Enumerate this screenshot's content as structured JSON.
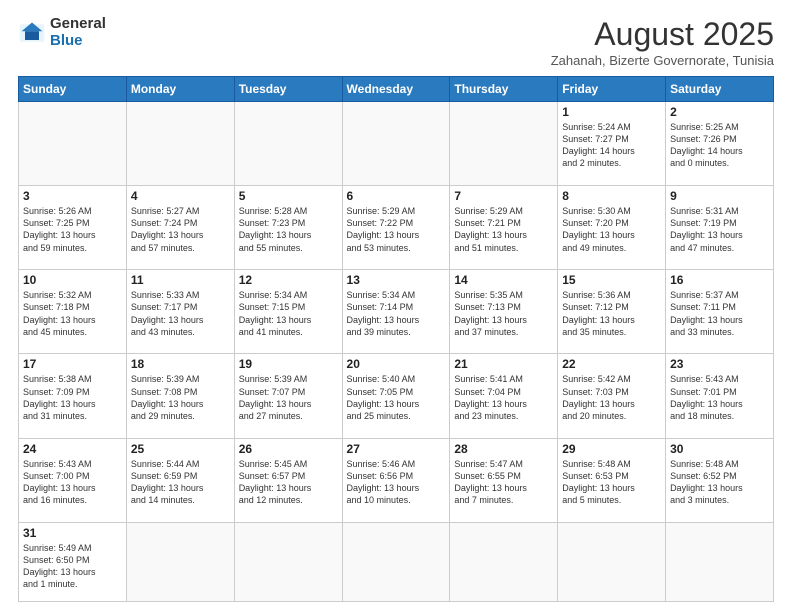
{
  "header": {
    "logo_general": "General",
    "logo_blue": "Blue",
    "month_title": "August 2025",
    "subtitle": "Zahanah, Bizerte Governorate, Tunisia"
  },
  "days_of_week": [
    "Sunday",
    "Monday",
    "Tuesday",
    "Wednesday",
    "Thursday",
    "Friday",
    "Saturday"
  ],
  "weeks": [
    [
      {
        "day": "",
        "info": ""
      },
      {
        "day": "",
        "info": ""
      },
      {
        "day": "",
        "info": ""
      },
      {
        "day": "",
        "info": ""
      },
      {
        "day": "",
        "info": ""
      },
      {
        "day": "1",
        "info": "Sunrise: 5:24 AM\nSunset: 7:27 PM\nDaylight: 14 hours\nand 2 minutes."
      },
      {
        "day": "2",
        "info": "Sunrise: 5:25 AM\nSunset: 7:26 PM\nDaylight: 14 hours\nand 0 minutes."
      }
    ],
    [
      {
        "day": "3",
        "info": "Sunrise: 5:26 AM\nSunset: 7:25 PM\nDaylight: 13 hours\nand 59 minutes."
      },
      {
        "day": "4",
        "info": "Sunrise: 5:27 AM\nSunset: 7:24 PM\nDaylight: 13 hours\nand 57 minutes."
      },
      {
        "day": "5",
        "info": "Sunrise: 5:28 AM\nSunset: 7:23 PM\nDaylight: 13 hours\nand 55 minutes."
      },
      {
        "day": "6",
        "info": "Sunrise: 5:29 AM\nSunset: 7:22 PM\nDaylight: 13 hours\nand 53 minutes."
      },
      {
        "day": "7",
        "info": "Sunrise: 5:29 AM\nSunset: 7:21 PM\nDaylight: 13 hours\nand 51 minutes."
      },
      {
        "day": "8",
        "info": "Sunrise: 5:30 AM\nSunset: 7:20 PM\nDaylight: 13 hours\nand 49 minutes."
      },
      {
        "day": "9",
        "info": "Sunrise: 5:31 AM\nSunset: 7:19 PM\nDaylight: 13 hours\nand 47 minutes."
      }
    ],
    [
      {
        "day": "10",
        "info": "Sunrise: 5:32 AM\nSunset: 7:18 PM\nDaylight: 13 hours\nand 45 minutes."
      },
      {
        "day": "11",
        "info": "Sunrise: 5:33 AM\nSunset: 7:17 PM\nDaylight: 13 hours\nand 43 minutes."
      },
      {
        "day": "12",
        "info": "Sunrise: 5:34 AM\nSunset: 7:15 PM\nDaylight: 13 hours\nand 41 minutes."
      },
      {
        "day": "13",
        "info": "Sunrise: 5:34 AM\nSunset: 7:14 PM\nDaylight: 13 hours\nand 39 minutes."
      },
      {
        "day": "14",
        "info": "Sunrise: 5:35 AM\nSunset: 7:13 PM\nDaylight: 13 hours\nand 37 minutes."
      },
      {
        "day": "15",
        "info": "Sunrise: 5:36 AM\nSunset: 7:12 PM\nDaylight: 13 hours\nand 35 minutes."
      },
      {
        "day": "16",
        "info": "Sunrise: 5:37 AM\nSunset: 7:11 PM\nDaylight: 13 hours\nand 33 minutes."
      }
    ],
    [
      {
        "day": "17",
        "info": "Sunrise: 5:38 AM\nSunset: 7:09 PM\nDaylight: 13 hours\nand 31 minutes."
      },
      {
        "day": "18",
        "info": "Sunrise: 5:39 AM\nSunset: 7:08 PM\nDaylight: 13 hours\nand 29 minutes."
      },
      {
        "day": "19",
        "info": "Sunrise: 5:39 AM\nSunset: 7:07 PM\nDaylight: 13 hours\nand 27 minutes."
      },
      {
        "day": "20",
        "info": "Sunrise: 5:40 AM\nSunset: 7:05 PM\nDaylight: 13 hours\nand 25 minutes."
      },
      {
        "day": "21",
        "info": "Sunrise: 5:41 AM\nSunset: 7:04 PM\nDaylight: 13 hours\nand 23 minutes."
      },
      {
        "day": "22",
        "info": "Sunrise: 5:42 AM\nSunset: 7:03 PM\nDaylight: 13 hours\nand 20 minutes."
      },
      {
        "day": "23",
        "info": "Sunrise: 5:43 AM\nSunset: 7:01 PM\nDaylight: 13 hours\nand 18 minutes."
      }
    ],
    [
      {
        "day": "24",
        "info": "Sunrise: 5:43 AM\nSunset: 7:00 PM\nDaylight: 13 hours\nand 16 minutes."
      },
      {
        "day": "25",
        "info": "Sunrise: 5:44 AM\nSunset: 6:59 PM\nDaylight: 13 hours\nand 14 minutes."
      },
      {
        "day": "26",
        "info": "Sunrise: 5:45 AM\nSunset: 6:57 PM\nDaylight: 13 hours\nand 12 minutes."
      },
      {
        "day": "27",
        "info": "Sunrise: 5:46 AM\nSunset: 6:56 PM\nDaylight: 13 hours\nand 10 minutes."
      },
      {
        "day": "28",
        "info": "Sunrise: 5:47 AM\nSunset: 6:55 PM\nDaylight: 13 hours\nand 7 minutes."
      },
      {
        "day": "29",
        "info": "Sunrise: 5:48 AM\nSunset: 6:53 PM\nDaylight: 13 hours\nand 5 minutes."
      },
      {
        "day": "30",
        "info": "Sunrise: 5:48 AM\nSunset: 6:52 PM\nDaylight: 13 hours\nand 3 minutes."
      }
    ],
    [
      {
        "day": "31",
        "info": "Sunrise: 5:49 AM\nSunset: 6:50 PM\nDaylight: 13 hours\nand 1 minute."
      },
      {
        "day": "",
        "info": ""
      },
      {
        "day": "",
        "info": ""
      },
      {
        "day": "",
        "info": ""
      },
      {
        "day": "",
        "info": ""
      },
      {
        "day": "",
        "info": ""
      },
      {
        "day": "",
        "info": ""
      }
    ]
  ]
}
